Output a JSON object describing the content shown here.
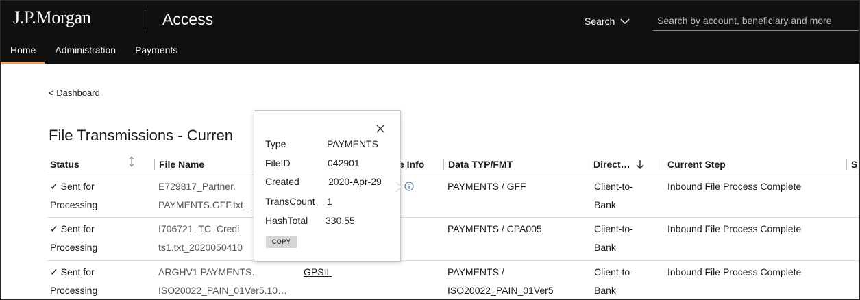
{
  "header": {
    "brand": "J.P.Morgan",
    "product": "Access",
    "search_mode": "Search",
    "search_placeholder": "Search by account, beneficiary and more"
  },
  "nav": {
    "items": [
      "Home",
      "Administration",
      "Payments"
    ]
  },
  "breadcrumb": {
    "back_label": "Dashboard"
  },
  "page": {
    "title": "File Transmissions - Curren"
  },
  "table": {
    "columns": {
      "status": "Status",
      "file_name": "File Name",
      "file_info": "e Info",
      "data_typ": "Data TYP/FMT",
      "direction": "Direct…",
      "current_step": "Current Step",
      "extra": "S"
    },
    "rows": [
      {
        "status_1": "✓ Sent for",
        "status_2": "Processing",
        "file_1": "E729817_Partner.",
        "file_2": "PAYMENTS.GFF.txt_",
        "data_1": "PAYMENTS / GFF",
        "data_2": "",
        "dir_1": "Client-to-",
        "dir_2": "Bank",
        "step": "Inbound File Process Complete"
      },
      {
        "status_1": "✓ Sent for",
        "status_2": "Processing",
        "file_1": "I706721_TC_Credi",
        "file_2": "ts1.txt_2020050410",
        "data_1": "PAYMENTS / CPA005",
        "data_2": "",
        "dir_1": "Client-to-",
        "dir_2": "Bank",
        "step": "Inbound File Process Complete"
      },
      {
        "status_1": "✓ Sent for",
        "status_2": "Processing",
        "file_1": "ARGHV1.PAYMENTS.",
        "file_2": "ISO20022_PAIN_01Ver5.10…",
        "info": "GPSIL",
        "data_1": "PAYMENTS /",
        "data_2": "ISO20022_PAIN_01Ver5",
        "dir_1": "Client-to-",
        "dir_2": "Bank",
        "step": "Inbound File Process Complete"
      }
    ]
  },
  "popup": {
    "fields": [
      {
        "key": "Type",
        "value": "PAYMENTS"
      },
      {
        "key": "FileID",
        "value": "042901"
      },
      {
        "key": "Created",
        "value": "2020-Apr-29"
      },
      {
        "key": "TransCount",
        "value": "1"
      },
      {
        "key": "HashTotal",
        "value": "330.55"
      }
    ],
    "copy_label": "COPY"
  },
  "colors": {
    "topbar": "#101010",
    "nav_active": "#f0a05a",
    "info_icon": "#2b6cb0"
  }
}
